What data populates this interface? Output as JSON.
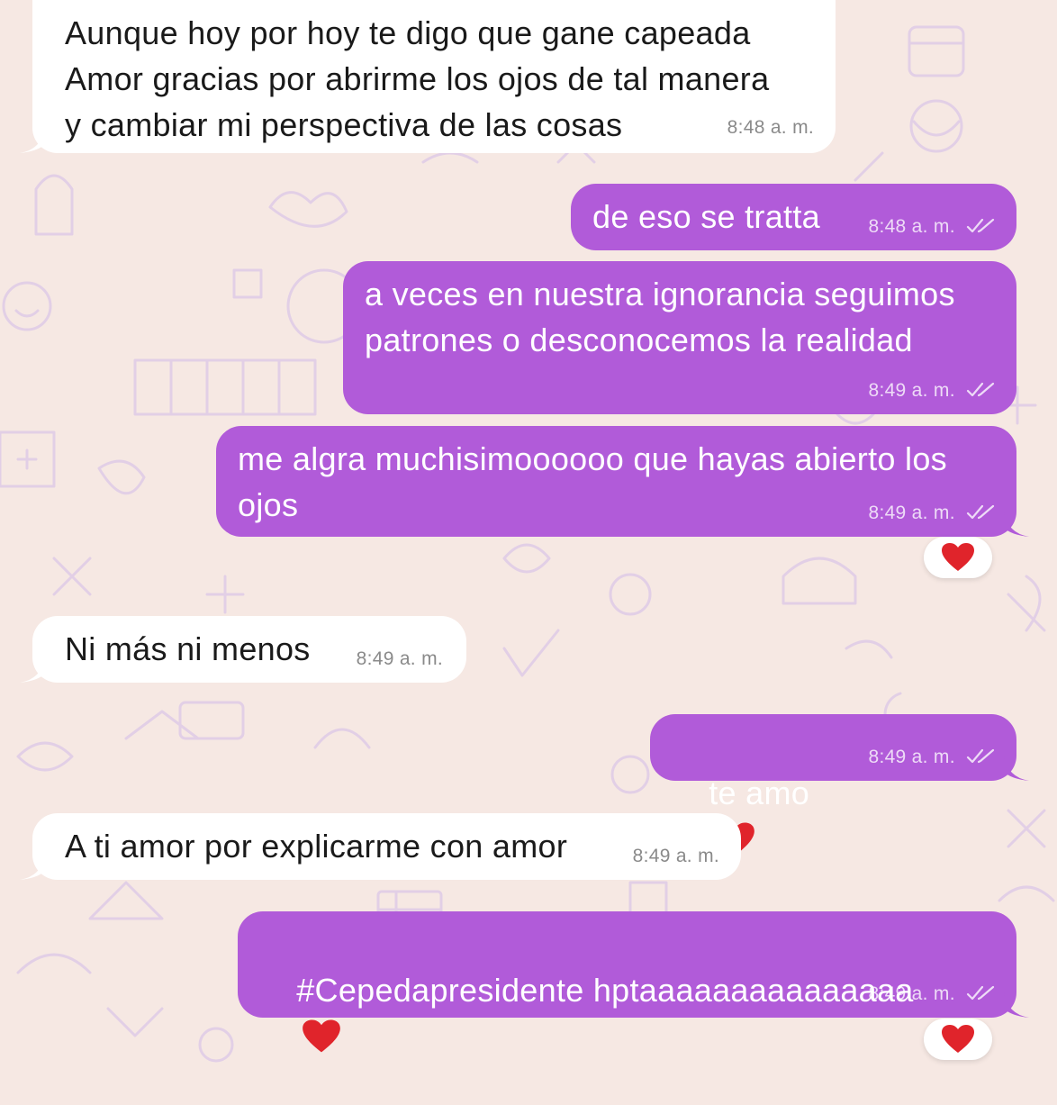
{
  "messages": [
    {
      "dir": "in",
      "text": "Aunque hoy por hoy te digo que gane capeada\nAmor gracias por abrirme los ojos de tal manera\ny cambiar mi perspectiva de las cosas",
      "time": "8:48 a. m."
    },
    {
      "dir": "out",
      "text": "de eso se tratta",
      "time": "8:48 a. m."
    },
    {
      "dir": "out",
      "text": "a veces en nuestra ignorancia seguimos\npatrones o desconocemos la realidad",
      "time": "8:49 a. m."
    },
    {
      "dir": "out",
      "text": "me algra muchisimoooooo que hayas abierto los\nojos",
      "time": "8:49 a. m.",
      "reaction": "heart"
    },
    {
      "dir": "in",
      "text": "Ni más ni menos",
      "time": "8:49 a. m."
    },
    {
      "dir": "out",
      "text": "te amo",
      "emoji": "heart",
      "time": "8:49 a. m."
    },
    {
      "dir": "in",
      "text": "A ti amor por explicarme con amor",
      "time": "8:49 a. m."
    },
    {
      "dir": "out",
      "text": "#Cepedapresidente hptaaaaaaaaaaaaaaa",
      "emoji": "heart",
      "time": "8:49 a. m.",
      "reaction": "heart"
    }
  ],
  "colors": {
    "background": "#f6e8e3",
    "incoming_bubble": "#ffffff",
    "outgoing_bubble": "#b15bd9",
    "heart": "#e0242b",
    "doodle": "#e2cfe6"
  },
  "icons": {
    "read_receipt": "double-check-icon",
    "reaction": "red-heart-icon"
  }
}
